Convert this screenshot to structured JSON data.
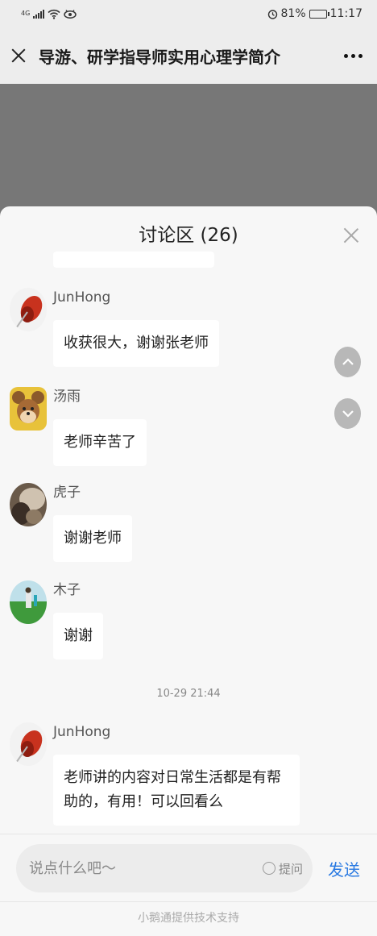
{
  "status_bar": {
    "network": "4G",
    "battery": "81%",
    "time": "11:17"
  },
  "nav": {
    "title": "导游、研学指导师实用心理学简介"
  },
  "panel": {
    "title": "讨论区 (26)"
  },
  "messages": [
    {
      "name": "JunHong",
      "text": "收获很大，谢谢张老师"
    },
    {
      "name": "汤雨",
      "text": "老师辛苦了"
    },
    {
      "name": "虎子",
      "text": "谢谢老师"
    },
    {
      "name": "木子",
      "text": "谢谢"
    },
    {
      "name": "JunHong",
      "text": "老师讲的内容对日常生活都是有帮助的，有用！可以回看么"
    }
  ],
  "timestamp": "10-29 21:44",
  "input": {
    "placeholder": "说点什么吧～",
    "ask_label": "提问",
    "send_label": "发送"
  },
  "footer": {
    "text": "小鹅通提供技术支持"
  },
  "colors": {
    "accent": "#2a7ae2",
    "panel_bg": "#f7f7f7",
    "overlay": "#777777"
  },
  "icons": [
    "close-icon",
    "more-icon",
    "scroll-up-icon",
    "scroll-down-icon",
    "radio-icon"
  ]
}
